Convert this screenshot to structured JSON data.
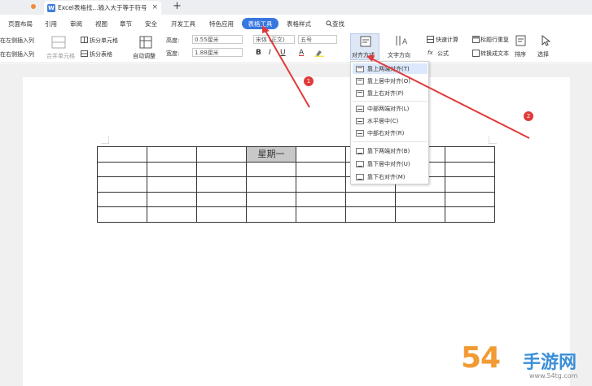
{
  "tabbar": {
    "doc_title": "Excel表格找...输入大于等于符号",
    "doc_icon_letter": "W",
    "close_glyph": "×",
    "new_tab_glyph": "+"
  },
  "menu": {
    "items": [
      "页面布局",
      "引用",
      "审阅",
      "视图",
      "章节",
      "安全",
      "开发工具",
      "特色应用"
    ],
    "active": "表格工具",
    "after": [
      "表格样式"
    ],
    "search": "查找"
  },
  "ribbon": {
    "insert_left": "在左侧插入列",
    "insert_right": "在右侧插入列",
    "merge_cells": "合并单元格",
    "split_cells": "拆分单元格",
    "split_table": "拆分表格",
    "auto_fit": "自动调整",
    "height_label": "高度:",
    "height_value": "0.55厘米",
    "width_label": "宽度:",
    "width_value": "1.88厘米",
    "font_name": "宋体 (正文)",
    "font_size": "五号",
    "bold": "B",
    "italic": "I",
    "underline": "U",
    "font_color": "A",
    "align_label": "对齐方式",
    "text_dir_label": "文字方向",
    "quick_calc": "快速计算",
    "formula": "公式",
    "repeat_header": "标题行重复",
    "convert_text": "转换成文本",
    "sort": "排序",
    "select": "选择"
  },
  "table": {
    "rows": [
      [
        "",
        "",
        "",
        "星期一",
        "",
        "",
        "",
        ""
      ],
      [
        "",
        "",
        "",
        "",
        "",
        "",
        "",
        ""
      ],
      [
        "",
        "",
        "",
        "",
        "",
        "",
        "",
        ""
      ],
      [
        "",
        "",
        "",
        "",
        "",
        "",
        "",
        ""
      ],
      [
        "",
        "",
        "",
        "",
        "",
        "",
        "",
        ""
      ]
    ]
  },
  "align_menu": {
    "groups": [
      [
        "靠上两端对齐(T)",
        "靠上居中对齐(O)",
        "靠上右对齐(P)"
      ],
      [
        "中部两端对齐(L)",
        "水平居中(C)",
        "中部右对齐(R)"
      ],
      [
        "靠下两端对齐(B)",
        "靠下居中对齐(U)",
        "靠下右对齐(M)"
      ]
    ]
  },
  "badges": {
    "one": "1",
    "two": "2"
  },
  "watermark": {
    "big": "54",
    "cn": "手游网",
    "url": "www.54tg.com"
  },
  "colors": {
    "accent": "#3777e0",
    "arrow": "#e03a3a",
    "watermark_orange": "#f29b34"
  }
}
